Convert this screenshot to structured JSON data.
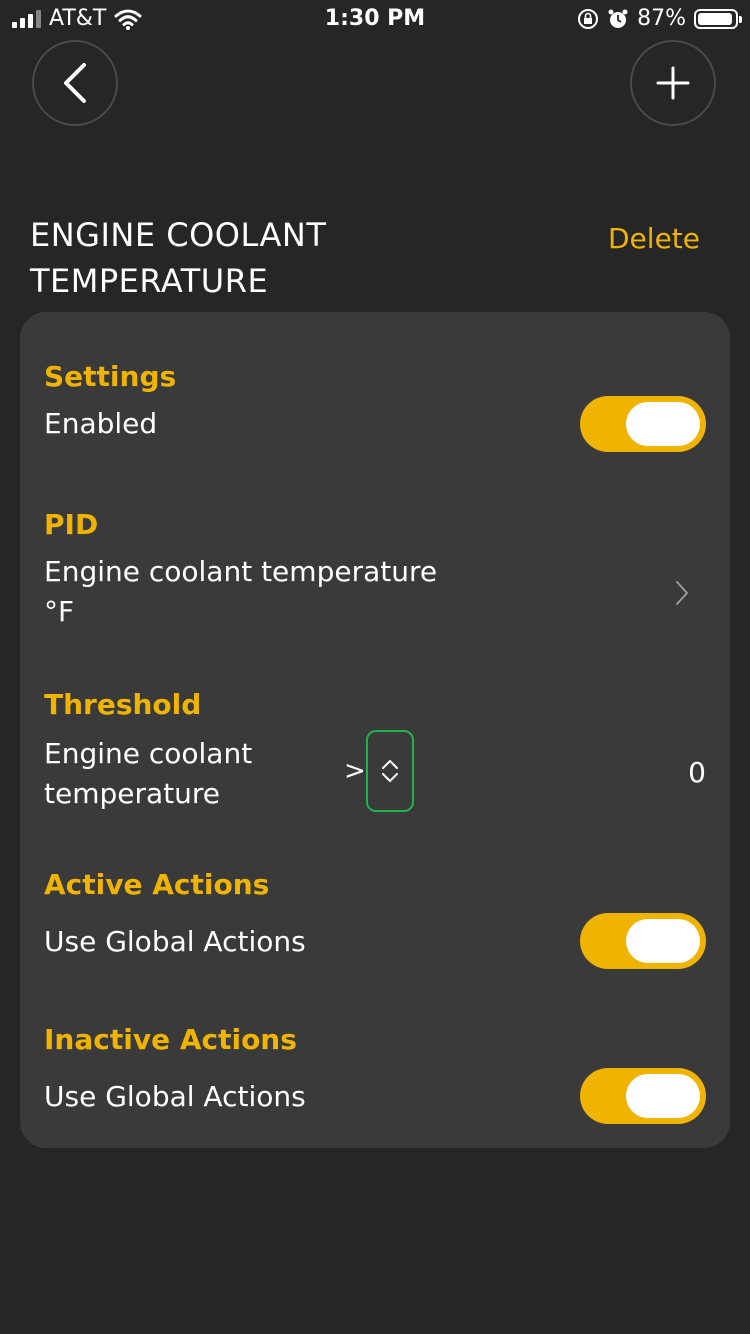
{
  "status_bar": {
    "carrier": "AT&T",
    "time": "1:30 PM",
    "battery_percent": "87%",
    "icons": [
      "signal-icon",
      "wifi-icon",
      "orientation-lock-icon",
      "alarm-icon",
      "battery-icon"
    ]
  },
  "header": {
    "title": "ENGINE COOLANT TEMPERATURE",
    "delete_label": "Delete"
  },
  "sections": {
    "settings": {
      "label": "Settings",
      "enabled_label": "Enabled",
      "enabled": true
    },
    "pid": {
      "label": "PID",
      "name": "Engine coolant temperature",
      "unit": "°F"
    },
    "threshold": {
      "label": "Threshold",
      "name": "Engine coolant temperature",
      "operator": ">",
      "value": "0"
    },
    "active_actions": {
      "label": "Active Actions",
      "option_label": "Use Global Actions",
      "enabled": true
    },
    "inactive_actions": {
      "label": "Inactive Actions",
      "option_label": "Use Global Actions",
      "enabled": true
    }
  },
  "colors": {
    "background": "#262626",
    "card": "#3a3a3a",
    "accent": "#f0b400",
    "highlight": "#22b14c"
  }
}
